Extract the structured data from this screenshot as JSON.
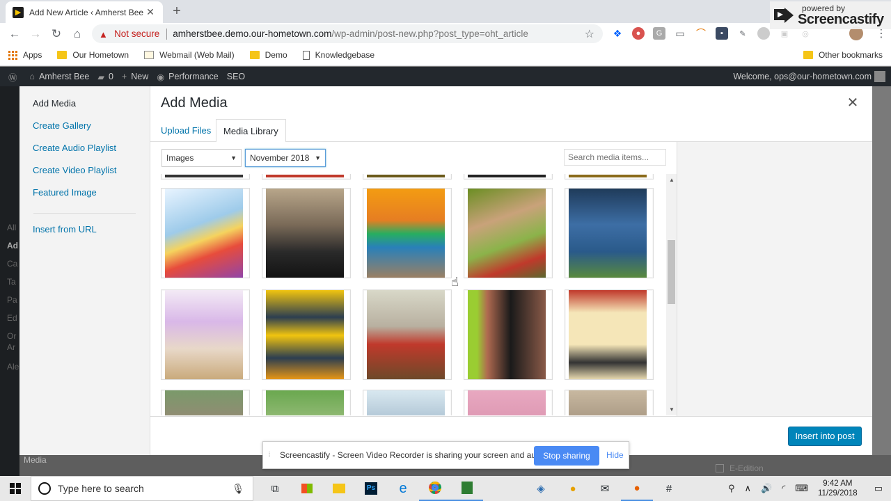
{
  "browser": {
    "tab_title": "Add New Article ‹ Amherst Bee —",
    "not_secure": "Not secure",
    "url_host": "amherstbee.demo.our-hometown.com",
    "url_path": "/wp-admin/post-new.php?post_type=oht_article",
    "bookmarks": [
      "Apps",
      "Our Hometown",
      "Webmail (Web Mail)",
      "Demo",
      "Knowledgebase"
    ],
    "other_bookmarks": "Other bookmarks",
    "powered_by": "powered by",
    "screencastify": "Screencastify"
  },
  "wpbar": {
    "site_name": "Amherst Bee",
    "comments_count": "0",
    "new_label": "New",
    "performance": "Performance",
    "seo": "SEO",
    "welcome": "Welcome, ops@our-hometown.com"
  },
  "background": {
    "side_ghosts": [
      "All",
      "Ad",
      "Ca",
      "Ta",
      "Pa",
      "Ed",
      "Or",
      "Ar",
      "Ale"
    ],
    "media_label": "Media",
    "edition_label": "E-Edition"
  },
  "modal": {
    "menu": [
      "Add Media",
      "Create Gallery",
      "Create Audio Playlist",
      "Create Video Playlist",
      "Featured Image"
    ],
    "insert_from_url": "Insert from URL",
    "title": "Add Media",
    "tabs": [
      "Upload Files",
      "Media Library"
    ],
    "filter_type": "Images",
    "filter_date": "November 2018",
    "search_placeholder": "Search media items...",
    "insert_button": "Insert into post"
  },
  "share_bar": {
    "message": "Screencastify - Screen Video Recorder is sharing your screen and audio.",
    "stop": "Stop sharing",
    "hide": "Hide"
  },
  "taskbar": {
    "search_placeholder": "Type here to search",
    "time": "9:42 AM",
    "date": "11/29/2018"
  }
}
